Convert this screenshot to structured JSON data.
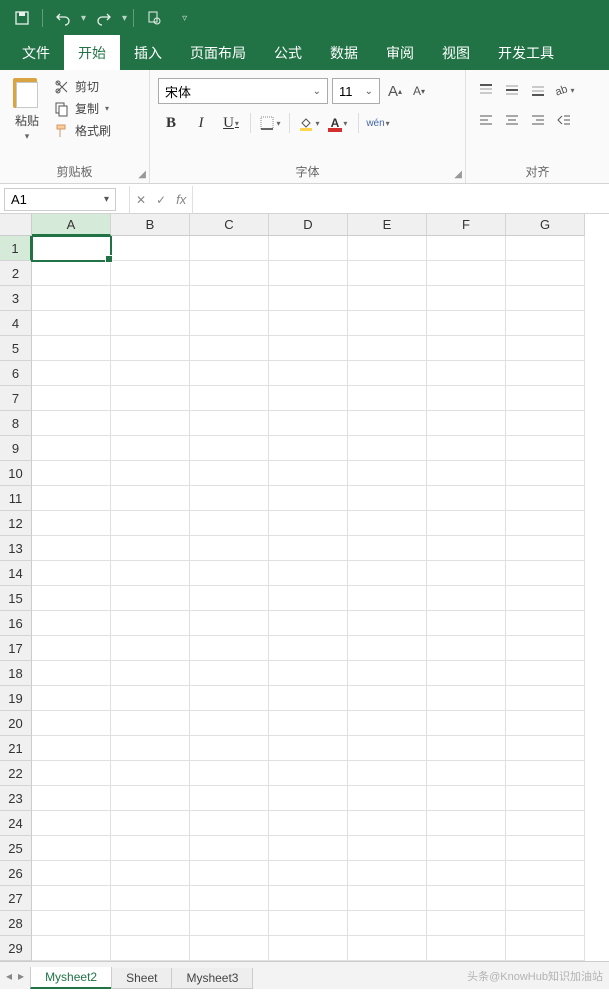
{
  "qat": {
    "save": "save",
    "undo": "undo",
    "redo": "redo",
    "preview": "preview"
  },
  "tabs": [
    "文件",
    "开始",
    "插入",
    "页面布局",
    "公式",
    "数据",
    "审阅",
    "视图",
    "开发工具"
  ],
  "active_tab": "开始",
  "clipboard": {
    "group_label": "剪贴板",
    "paste": "粘贴",
    "cut": "剪切",
    "copy": "复制",
    "format_painter": "格式刷"
  },
  "font": {
    "group_label": "字体",
    "name": "宋体",
    "size": "11",
    "wen": "wén"
  },
  "alignment": {
    "group_label": "对齐"
  },
  "name_box": "A1",
  "columns": [
    "A",
    "B",
    "C",
    "D",
    "E",
    "F",
    "G"
  ],
  "row_count": 29,
  "sheets": {
    "tabs": [
      "Mysheet2",
      "Sheet",
      "Mysheet3"
    ],
    "active": "Mysheet2"
  },
  "watermark": "头条@KnowHub知识加油站"
}
